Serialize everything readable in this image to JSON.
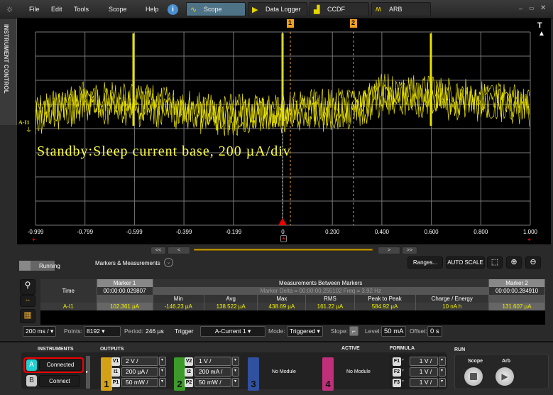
{
  "menu": {
    "items": [
      "File",
      "Edit",
      "Tools",
      "Scope",
      "Help"
    ]
  },
  "apps": [
    {
      "label": "Scope",
      "active": true
    },
    {
      "label": "Data Logger"
    },
    {
      "label": "CCDF"
    },
    {
      "label": "ARB"
    }
  ],
  "window_controls": [
    "minimize",
    "maximize",
    "close"
  ],
  "side_tab": "INSTRUMENT CONTROL",
  "scope": {
    "annotation": "Standby:Sleep current base, 200 µA/div",
    "channel_label": "A-I1",
    "x_ticks": [
      "-0.999",
      "-0.799",
      "-0.599",
      "-0.399",
      "-0.199",
      "0",
      "0.200",
      "0.400",
      "0.600",
      "0.800",
      "1.000"
    ],
    "markers": [
      "1",
      "2"
    ],
    "trace_color": "#e8e000",
    "marker_color": "#f0a020",
    "trigger_label": "T"
  },
  "nav": {
    "first": "<<",
    "prev": "<",
    "next": ">",
    "last": ">>"
  },
  "panel": {
    "status": "Running",
    "section": "Markers & Measurements",
    "ranges": "Ranges...",
    "autoscale": "AUTO SCALE",
    "table": {
      "marker1": "Marker 1",
      "between": "Measurements Between Markers",
      "marker2": "Marker 2",
      "time_label": "Time",
      "m1_time": "00:00:00.029807",
      "delta": "Marker Delta = 00:00:00.255102   Freq = 3.92 Hz",
      "m2_time": "00:00:00.284910",
      "columns": [
        "Min",
        "Avg",
        "Max",
        "RMS",
        "Peak to Peak",
        "Charge / Energy"
      ],
      "row_label": "A-I1",
      "m1_value": "102.361 µA",
      "values": [
        "-146.23 µA",
        "138.522 µA",
        "438.69 µA",
        "161.22 µA",
        "584.92 µA",
        "10 nA h"
      ],
      "m2_value": "131.607 µA"
    },
    "controls": {
      "timebase": "200 ms /",
      "points_label": "Points:",
      "points": "8192",
      "period_label": "Period:",
      "period": "246 µs",
      "trigger_label": "Trigger",
      "trigger": "A-Current 1",
      "mode_label": "Mode:",
      "mode": "Triggered",
      "slope_label": "Slope:",
      "level_label": "Level:",
      "level": "50 mA",
      "offset_label": "Offset:",
      "offset": "0 s"
    }
  },
  "bottom": {
    "instruments_label": "INSTRUMENTS",
    "outputs_label": "OUTPUTS",
    "active_label": "ACTIVE",
    "formula_label": "FORMULA",
    "run_label": "RUN",
    "instA": {
      "letter": "A",
      "status": "Connected"
    },
    "instB": {
      "letter": "B",
      "status": "Connect"
    },
    "out1": {
      "num": "1",
      "color": "#d4a017",
      "rows": [
        {
          "tag": "V1",
          "value": "2 V /"
        },
        {
          "tag": "I1",
          "value": "200 µA /"
        },
        {
          "tag": "P1",
          "value": "50 mW /"
        }
      ]
    },
    "out2": {
      "num": "2",
      "color": "#3c9a2a",
      "rows": [
        {
          "tag": "V2",
          "value": "1 V /"
        },
        {
          "tag": "I2",
          "value": "200 mA /"
        },
        {
          "tag": "P2",
          "value": "50 mW /"
        }
      ]
    },
    "out3": {
      "num": "3",
      "color": "#3050a0",
      "text": "No Module"
    },
    "out4": {
      "num": "4",
      "color": "#c0307a",
      "text": "No Module"
    },
    "formulas": [
      {
        "tag": "F1",
        "value": "1 V /"
      },
      {
        "tag": "F2",
        "value": "1 V /"
      },
      {
        "tag": "F3",
        "value": "1 V /"
      }
    ],
    "run": {
      "scope": "Scope",
      "arb": "Arb"
    }
  }
}
